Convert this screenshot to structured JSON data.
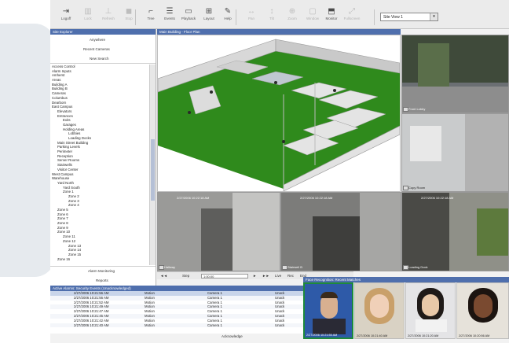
{
  "toolbar": {
    "buttons": [
      {
        "label": "Logoff",
        "icon": "arrow-icon",
        "enabled": true
      },
      {
        "label": "Lock",
        "icon": "lock-icon",
        "enabled": false
      },
      {
        "label": "Refresh",
        "icon": "refresh-icon",
        "enabled": false
      },
      {
        "label": "Stop",
        "icon": "stop-icon",
        "enabled": false
      },
      {
        "label": "Tree",
        "icon": "tree-icon",
        "enabled": true
      },
      {
        "label": "Events",
        "icon": "events-icon",
        "enabled": true
      },
      {
        "label": "Playback",
        "icon": "playback-icon",
        "enabled": true
      },
      {
        "label": "Layout",
        "icon": "layout-icon",
        "enabled": true
      },
      {
        "label": "Help",
        "icon": "help-icon",
        "enabled": true
      },
      {
        "label": "Pan",
        "icon": "pan-icon",
        "enabled": false
      },
      {
        "label": "Tilt",
        "icon": "tilt-icon",
        "enabled": false
      },
      {
        "label": "Zoom",
        "icon": "zoom-icon",
        "enabled": false
      },
      {
        "label": "Window",
        "icon": "window-icon",
        "enabled": false
      },
      {
        "label": "Monitor",
        "icon": "monitor-icon",
        "enabled": true
      },
      {
        "label": "Fullscreen",
        "icon": "fullscreen-icon",
        "enabled": false
      }
    ],
    "camera_select": "Site View 1"
  },
  "left": {
    "header": "Site Explorer",
    "top_items": [
      "Anywhere",
      "Recent Cameras",
      "New Search"
    ],
    "tree": [
      "Access Control",
      "Alarm Inputs",
      "Amherst",
      "Areas",
      "Building A",
      "Building B",
      "Cameras",
      "Columbus",
      "Dearborn",
      "East Campus",
      "Elevators",
      "Entrances",
      "Exits",
      "Garages",
      "Holding Areas",
      "Lobbies",
      "Loading Docks",
      "Main Street Building",
      "Parking Levels",
      "Perimeter",
      "Reception",
      "Server Rooms",
      "Stairwells",
      "Visitor Center",
      "West Campus",
      "Warehouse",
      "Yard North",
      "Yard South",
      "Zone 1",
      "Zone 2",
      "Zone 3",
      "Zone 4",
      "Zone 5",
      "Zone 6",
      "Zone 7",
      "Zone 8",
      "Zone 9",
      "Zone 10",
      "Zone 11",
      "Zone 12",
      "Zone 13",
      "Zone 14",
      "Zone 15",
      "Zone 16"
    ],
    "bottom_buttons": [
      "Alarm Monitoring",
      "Reports"
    ]
  },
  "view": {
    "header": "Main Building - Floor Plan",
    "cameras": [
      {
        "label": "Front Lobby",
        "timestamp": ""
      },
      {
        "label": "Copy Room",
        "timestamp": ""
      },
      {
        "label": "Hallway",
        "timestamp": "2/27/2006 10:22:18 AM"
      },
      {
        "label": "Stairwell B",
        "timestamp": "2/27/2006 10:22:18 AM"
      },
      {
        "label": "Loading Dock",
        "timestamp": "2/27/2006 10:22:18 AM"
      }
    ]
  },
  "playbar": {
    "prev_label": "◄◄",
    "step_label": "Step",
    "select_value": "1:00:00",
    "play_label": "►",
    "next_label": "►►",
    "live_label": "Live",
    "rec_label": "Rec",
    "end_label": "End"
  },
  "alarms": {
    "header": "Active Alarms: Security Events (Unacknowledged)",
    "rows": [
      {
        "time": "2/27/2006 10:21:56 AM",
        "type": "Motion",
        "source": "Camera 1",
        "status": "Unack"
      },
      {
        "time": "2/27/2006 10:21:56 AM",
        "type": "Motion",
        "source": "Camera 1",
        "status": "Unack"
      },
      {
        "time": "2/27/2006 10:21:52 AM",
        "type": "Motion",
        "source": "Camera 1",
        "status": "Unack"
      },
      {
        "time": "2/27/2006 10:21:49 AM",
        "type": "Motion",
        "source": "Camera 1",
        "status": "Unack"
      },
      {
        "time": "2/27/2006 10:21:47 AM",
        "type": "Motion",
        "source": "Camera 1",
        "status": "Unack"
      },
      {
        "time": "2/27/2006 10:21:45 AM",
        "type": "Motion",
        "source": "Camera 1",
        "status": "Unack"
      },
      {
        "time": "2/27/2006 10:21:42 AM",
        "type": "Motion",
        "source": "Camera 1",
        "status": "Unack"
      },
      {
        "time": "2/27/2006 10:21:40 AM",
        "type": "Motion",
        "source": "Camera 1",
        "status": "Unack"
      }
    ],
    "ack_label": "Acknowledge"
  },
  "faces": {
    "header": "Face Recognition: Recent Matches",
    "items": [
      {
        "caption": "2/27/2006 10:21:55 AM"
      },
      {
        "caption": "2/27/2006 10:21:40 AM"
      },
      {
        "caption": "2/27/2006 10:21:20 AM"
      },
      {
        "caption": "2/27/2006 10:20:56 AM"
      }
    ]
  }
}
